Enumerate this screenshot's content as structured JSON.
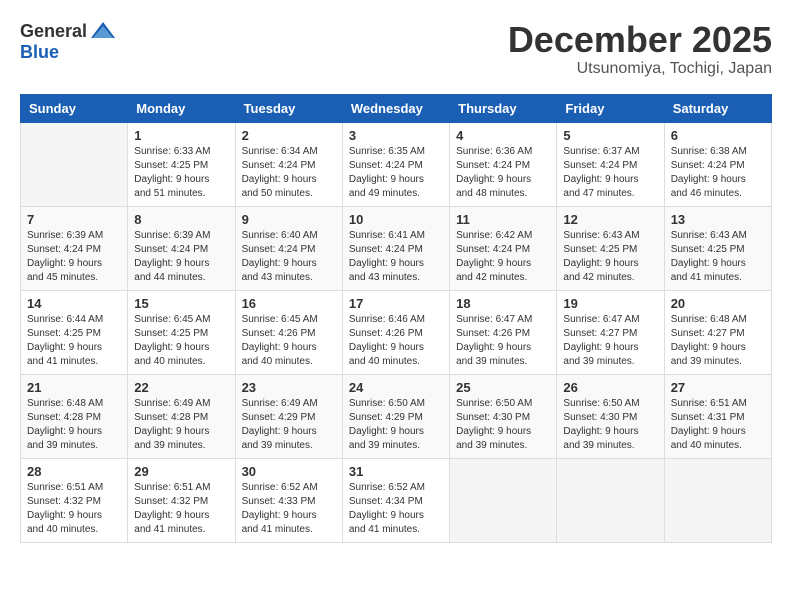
{
  "logo": {
    "general": "General",
    "blue": "Blue"
  },
  "header": {
    "month": "December 2025",
    "location": "Utsunomiya, Tochigi, Japan"
  },
  "weekdays": [
    "Sunday",
    "Monday",
    "Tuesday",
    "Wednesday",
    "Thursday",
    "Friday",
    "Saturday"
  ],
  "weeks": [
    [
      {
        "day": "",
        "info": ""
      },
      {
        "day": "1",
        "info": "Sunrise: 6:33 AM\nSunset: 4:25 PM\nDaylight: 9 hours\nand 51 minutes."
      },
      {
        "day": "2",
        "info": "Sunrise: 6:34 AM\nSunset: 4:24 PM\nDaylight: 9 hours\nand 50 minutes."
      },
      {
        "day": "3",
        "info": "Sunrise: 6:35 AM\nSunset: 4:24 PM\nDaylight: 9 hours\nand 49 minutes."
      },
      {
        "day": "4",
        "info": "Sunrise: 6:36 AM\nSunset: 4:24 PM\nDaylight: 9 hours\nand 48 minutes."
      },
      {
        "day": "5",
        "info": "Sunrise: 6:37 AM\nSunset: 4:24 PM\nDaylight: 9 hours\nand 47 minutes."
      },
      {
        "day": "6",
        "info": "Sunrise: 6:38 AM\nSunset: 4:24 PM\nDaylight: 9 hours\nand 46 minutes."
      }
    ],
    [
      {
        "day": "7",
        "info": "Sunrise: 6:39 AM\nSunset: 4:24 PM\nDaylight: 9 hours\nand 45 minutes."
      },
      {
        "day": "8",
        "info": "Sunrise: 6:39 AM\nSunset: 4:24 PM\nDaylight: 9 hours\nand 44 minutes."
      },
      {
        "day": "9",
        "info": "Sunrise: 6:40 AM\nSunset: 4:24 PM\nDaylight: 9 hours\nand 43 minutes."
      },
      {
        "day": "10",
        "info": "Sunrise: 6:41 AM\nSunset: 4:24 PM\nDaylight: 9 hours\nand 43 minutes."
      },
      {
        "day": "11",
        "info": "Sunrise: 6:42 AM\nSunset: 4:24 PM\nDaylight: 9 hours\nand 42 minutes."
      },
      {
        "day": "12",
        "info": "Sunrise: 6:43 AM\nSunset: 4:25 PM\nDaylight: 9 hours\nand 42 minutes."
      },
      {
        "day": "13",
        "info": "Sunrise: 6:43 AM\nSunset: 4:25 PM\nDaylight: 9 hours\nand 41 minutes."
      }
    ],
    [
      {
        "day": "14",
        "info": "Sunrise: 6:44 AM\nSunset: 4:25 PM\nDaylight: 9 hours\nand 41 minutes."
      },
      {
        "day": "15",
        "info": "Sunrise: 6:45 AM\nSunset: 4:25 PM\nDaylight: 9 hours\nand 40 minutes."
      },
      {
        "day": "16",
        "info": "Sunrise: 6:45 AM\nSunset: 4:26 PM\nDaylight: 9 hours\nand 40 minutes."
      },
      {
        "day": "17",
        "info": "Sunrise: 6:46 AM\nSunset: 4:26 PM\nDaylight: 9 hours\nand 40 minutes."
      },
      {
        "day": "18",
        "info": "Sunrise: 6:47 AM\nSunset: 4:26 PM\nDaylight: 9 hours\nand 39 minutes."
      },
      {
        "day": "19",
        "info": "Sunrise: 6:47 AM\nSunset: 4:27 PM\nDaylight: 9 hours\nand 39 minutes."
      },
      {
        "day": "20",
        "info": "Sunrise: 6:48 AM\nSunset: 4:27 PM\nDaylight: 9 hours\nand 39 minutes."
      }
    ],
    [
      {
        "day": "21",
        "info": "Sunrise: 6:48 AM\nSunset: 4:28 PM\nDaylight: 9 hours\nand 39 minutes."
      },
      {
        "day": "22",
        "info": "Sunrise: 6:49 AM\nSunset: 4:28 PM\nDaylight: 9 hours\nand 39 minutes."
      },
      {
        "day": "23",
        "info": "Sunrise: 6:49 AM\nSunset: 4:29 PM\nDaylight: 9 hours\nand 39 minutes."
      },
      {
        "day": "24",
        "info": "Sunrise: 6:50 AM\nSunset: 4:29 PM\nDaylight: 9 hours\nand 39 minutes."
      },
      {
        "day": "25",
        "info": "Sunrise: 6:50 AM\nSunset: 4:30 PM\nDaylight: 9 hours\nand 39 minutes."
      },
      {
        "day": "26",
        "info": "Sunrise: 6:50 AM\nSunset: 4:30 PM\nDaylight: 9 hours\nand 39 minutes."
      },
      {
        "day": "27",
        "info": "Sunrise: 6:51 AM\nSunset: 4:31 PM\nDaylight: 9 hours\nand 40 minutes."
      }
    ],
    [
      {
        "day": "28",
        "info": "Sunrise: 6:51 AM\nSunset: 4:32 PM\nDaylight: 9 hours\nand 40 minutes."
      },
      {
        "day": "29",
        "info": "Sunrise: 6:51 AM\nSunset: 4:32 PM\nDaylight: 9 hours\nand 41 minutes."
      },
      {
        "day": "30",
        "info": "Sunrise: 6:52 AM\nSunset: 4:33 PM\nDaylight: 9 hours\nand 41 minutes."
      },
      {
        "day": "31",
        "info": "Sunrise: 6:52 AM\nSunset: 4:34 PM\nDaylight: 9 hours\nand 41 minutes."
      },
      {
        "day": "",
        "info": ""
      },
      {
        "day": "",
        "info": ""
      },
      {
        "day": "",
        "info": ""
      }
    ]
  ]
}
